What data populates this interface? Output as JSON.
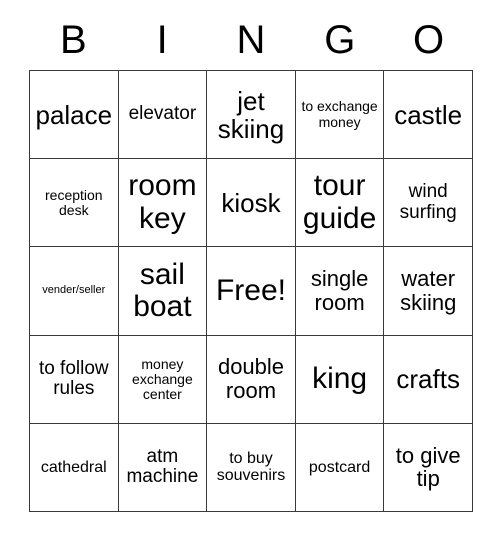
{
  "header": {
    "letters": [
      "B",
      "I",
      "N",
      "G",
      "O"
    ]
  },
  "grid": {
    "rows": 5,
    "columns": 5,
    "border_color": "#3a3a3a",
    "background_color": "#ffffff",
    "text_color": "#000000",
    "cells": [
      {
        "text": "palace",
        "size": "fs-xxl"
      },
      {
        "text": "elevator",
        "size": "fs-lg"
      },
      {
        "text": "jet skiing",
        "size": "fs-xxl"
      },
      {
        "text": "to exchange money",
        "size": "fs-sm"
      },
      {
        "text": "castle",
        "size": "fs-xxl"
      },
      {
        "text": "reception desk",
        "size": "fs-sm"
      },
      {
        "text": "room key",
        "size": "fs-huge"
      },
      {
        "text": "kiosk",
        "size": "fs-xxl"
      },
      {
        "text": "tour guide",
        "size": "fs-huge"
      },
      {
        "text": "wind surfing",
        "size": "fs-lg"
      },
      {
        "text": "vender/seller",
        "size": "fs-xs"
      },
      {
        "text": "sail boat",
        "size": "fs-huge"
      },
      {
        "text": "Free!",
        "size": "fs-huge"
      },
      {
        "text": "single room",
        "size": "fs-xl"
      },
      {
        "text": "water skiing",
        "size": "fs-xl"
      },
      {
        "text": "to follow rules",
        "size": "fs-lg"
      },
      {
        "text": "money exchange center",
        "size": "fs-sm"
      },
      {
        "text": "double room",
        "size": "fs-xl"
      },
      {
        "text": "king",
        "size": "fs-huge"
      },
      {
        "text": "crafts",
        "size": "fs-xxl"
      },
      {
        "text": "cathedral",
        "size": "fs-md"
      },
      {
        "text": "atm machine",
        "size": "fs-lg"
      },
      {
        "text": "to buy souvenirs",
        "size": "fs-md"
      },
      {
        "text": "postcard",
        "size": "fs-md"
      },
      {
        "text": "to give tip",
        "size": "fs-xl"
      }
    ]
  }
}
